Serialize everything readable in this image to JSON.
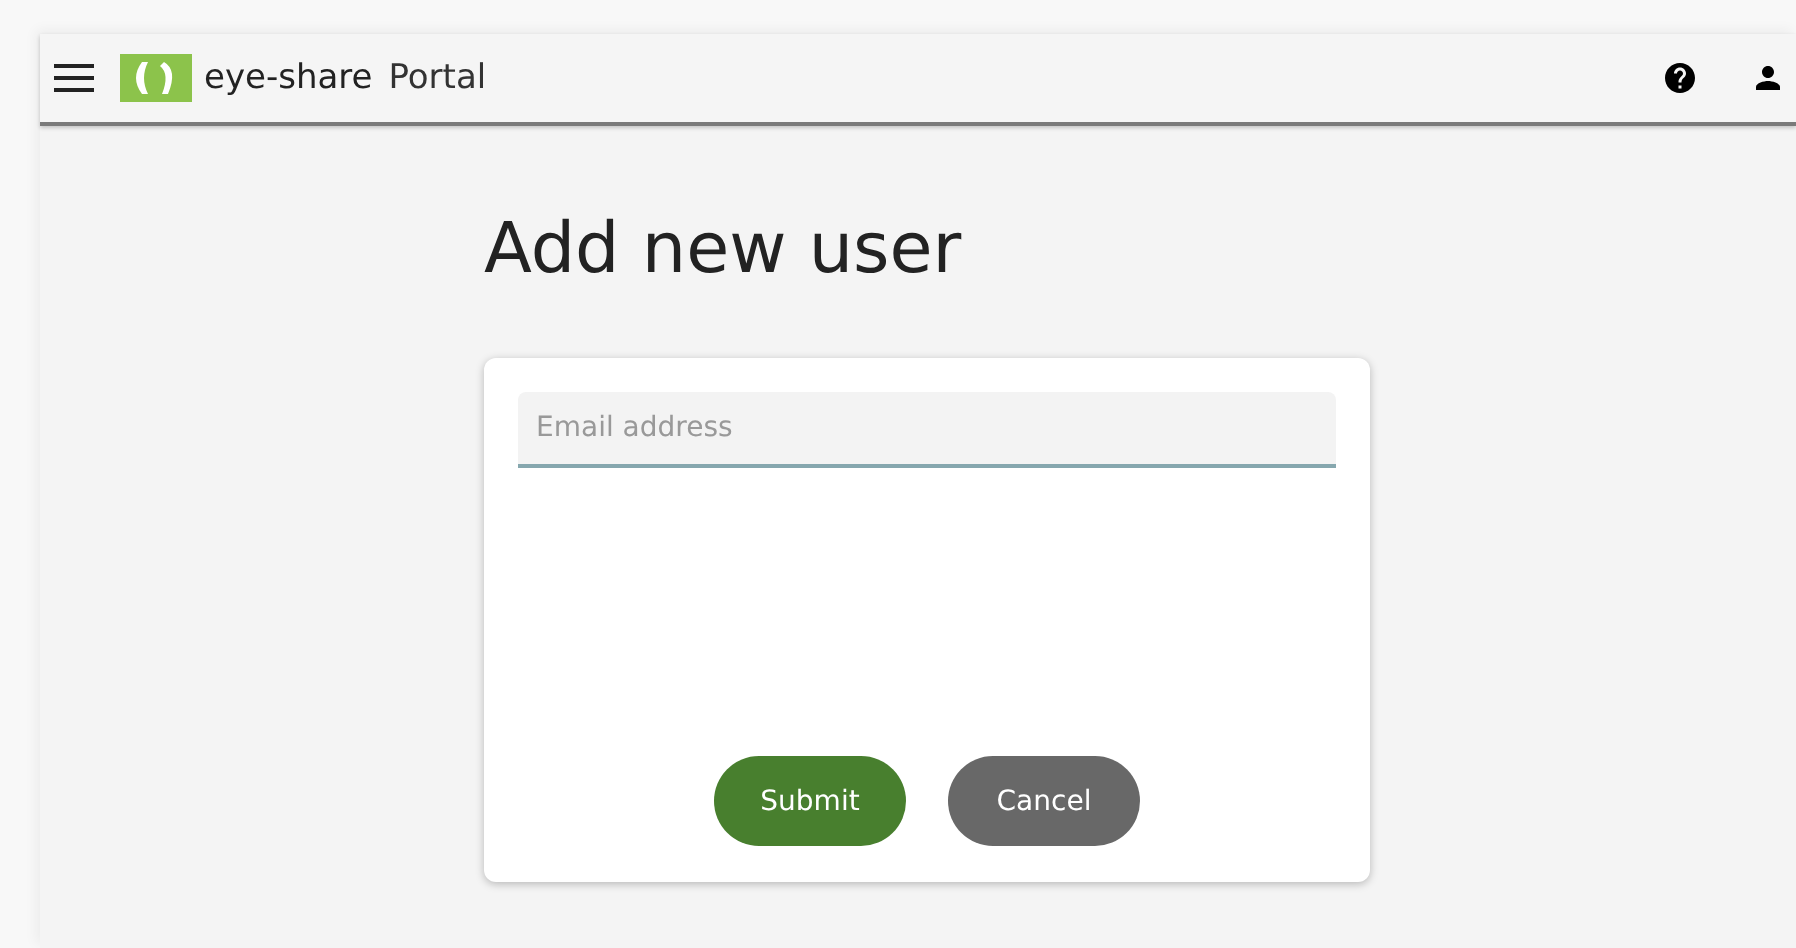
{
  "header": {
    "brand": "eye-share",
    "product": "Portal"
  },
  "page": {
    "title": "Add new user"
  },
  "form": {
    "email": {
      "placeholder": "Email address"
    },
    "buttons": [
      {
        "label": "Submit",
        "kind": "primary"
      },
      {
        "label": "Cancel",
        "kind": "secondary"
      }
    ]
  }
}
